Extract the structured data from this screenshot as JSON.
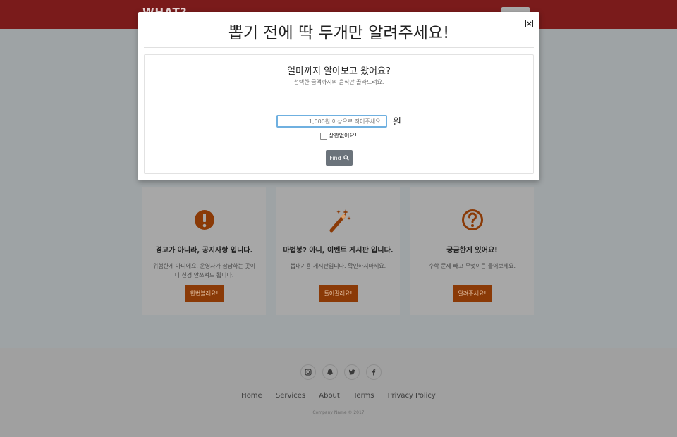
{
  "header": {
    "brand": "WHAT?"
  },
  "modal": {
    "title": "뽑기 전에 딱 두개만 알려주세요!",
    "question": "얼마까지 알아보고 왔어요?",
    "subtitle": "선택한 금액까지의 음식만 골라드려요.",
    "price_placeholder": "1,000원 이상으로 적어주세요.",
    "currency": "원",
    "checkbox_label": "상관없어요!",
    "find_label": "Find"
  },
  "cards": [
    {
      "icon": "exclamation-circle-icon",
      "title": "경고가 아니라, 공지사항 입니다.",
      "desc": "위험한게 아니에요. 운영자가 잡담하는 곳이니 신경 안쓰셔도 됩니다.",
      "button": "한번볼래요!"
    },
    {
      "icon": "magic-wand-icon",
      "title": "마법봉? 아니, 이벤트 게시판 입니다.",
      "desc": "뽑내기용 게시판입니다. 확인하지마세요.",
      "button": "들어갈래요!"
    },
    {
      "icon": "question-circle-icon",
      "title": "궁금한게 있어요!",
      "desc": "수학 문제 빼고 무엇이든 물어보세요.",
      "button": "알려주세요!"
    }
  ],
  "footer": {
    "socials": [
      "instagram-icon",
      "snapchat-icon",
      "twitter-icon",
      "facebook-icon"
    ],
    "links": [
      "Home",
      "Services",
      "About",
      "Terms",
      "Privacy Policy"
    ],
    "copyright": "Company Name © 2017"
  },
  "colors": {
    "header": "#7a1b1b",
    "accent": "#8a3a07",
    "find_button": "#6b737b"
  }
}
